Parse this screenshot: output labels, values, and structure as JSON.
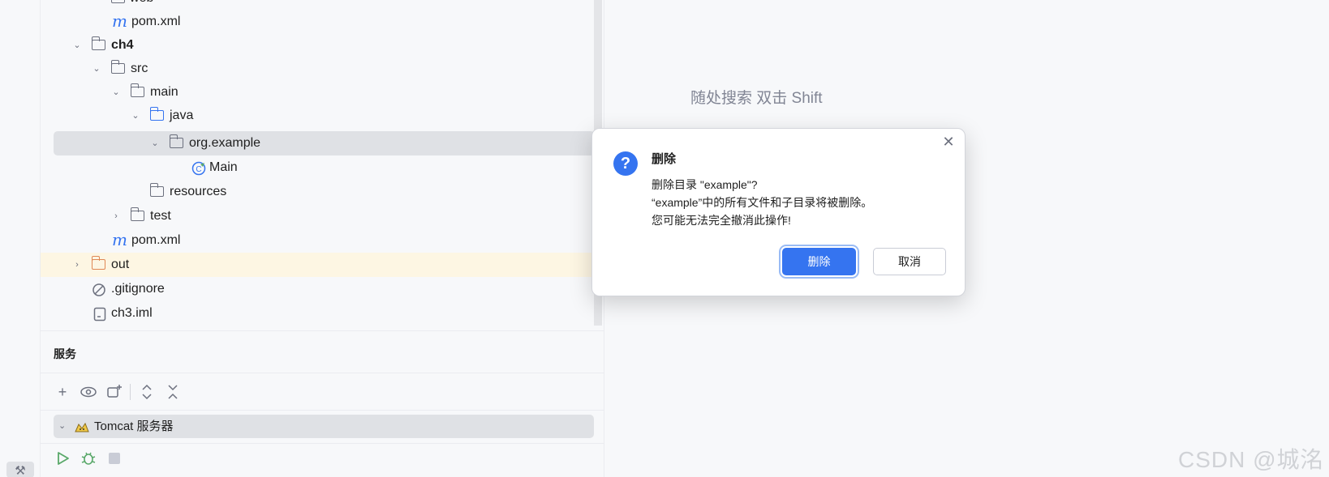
{
  "project_tree": {
    "rows": [
      {
        "label": "web",
        "icon": "folder-icon"
      },
      {
        "label": "pom.xml",
        "icon": "maven-file-icon",
        "glyph": "m"
      },
      {
        "label": "ch4",
        "icon": "module-folder-icon"
      },
      {
        "label": "src",
        "icon": "folder-icon"
      },
      {
        "label": "main",
        "icon": "folder-icon"
      },
      {
        "label": "java",
        "icon": "source-folder-icon"
      },
      {
        "label": "org.example",
        "icon": "package-icon"
      },
      {
        "label": "Main",
        "icon": "java-class-icon"
      },
      {
        "label": "resources",
        "icon": "resources-folder-icon"
      },
      {
        "label": "test",
        "icon": "folder-icon"
      },
      {
        "label": "pom.xml",
        "icon": "maven-file-icon",
        "glyph": "m"
      },
      {
        "label": "out",
        "icon": "excluded-folder-icon"
      },
      {
        "label": ".gitignore",
        "icon": "ignore-file-icon"
      },
      {
        "label": "ch3.iml",
        "icon": "iml-file-icon"
      }
    ]
  },
  "services": {
    "title": "服务",
    "toolbar": [
      "add-icon",
      "eye-icon",
      "new-group-icon",
      "expand-all-icon",
      "collapse-all-icon"
    ],
    "node_label": "Tomcat 服务器",
    "run_toolbar": [
      "run-icon",
      "debug-icon",
      "stop-icon"
    ]
  },
  "editor": {
    "search_hint": "随处搜索 双击 Shift"
  },
  "watermark": "CSDN @城洺",
  "dialog": {
    "title": "删除",
    "line1": "删除目录 \"example\"?",
    "line2": "“example”中的所有文件和子目录将被删除。",
    "line3": "您可能无法完全撤消此操作!",
    "confirm_label": "删除",
    "cancel_label": "取消",
    "accent": "#3574f0"
  },
  "colors": {
    "selection": "#dfe1e5",
    "excluded_highlight": "#fdf6e3",
    "primary": "#3574f0"
  }
}
